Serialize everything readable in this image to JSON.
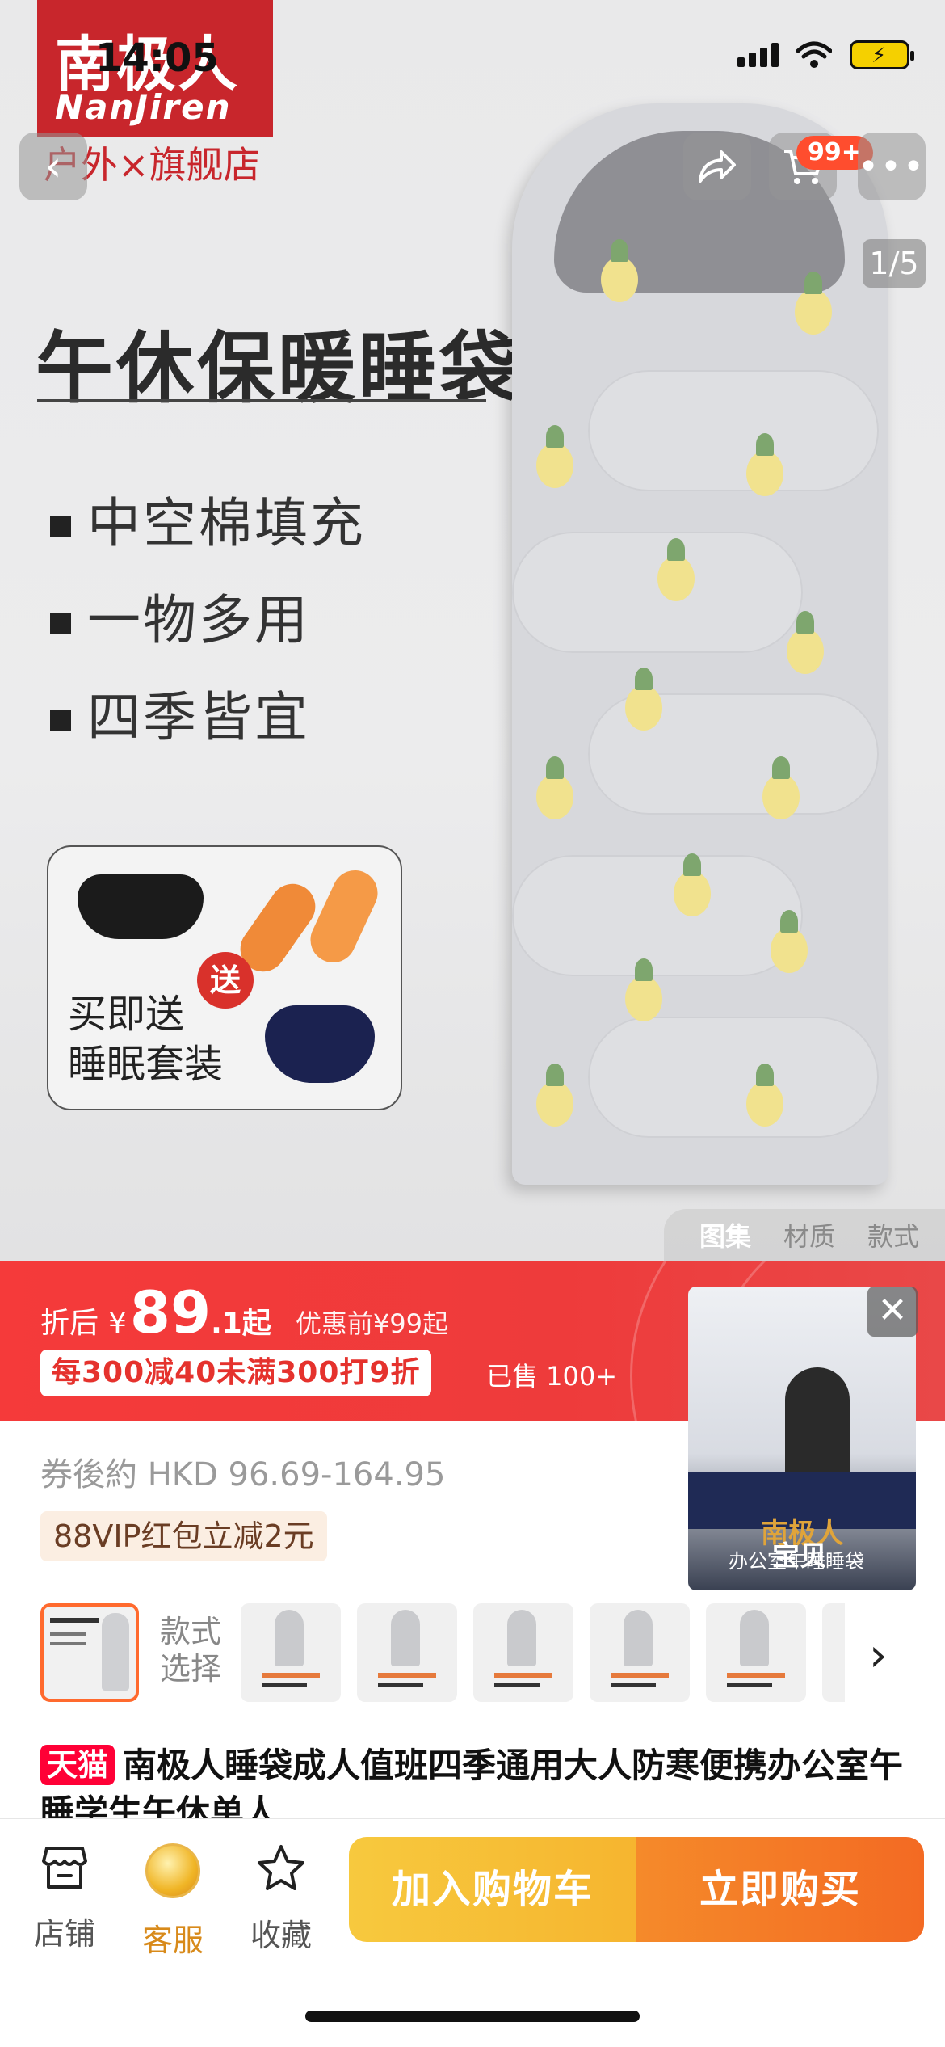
{
  "status_bar": {
    "time": "14:05"
  },
  "hero": {
    "brand_cn": "南极人",
    "brand_en": "NanJiren",
    "brand_sub": "户外×旗舰店",
    "title": "午休保暖睡袋",
    "features": [
      "中空棉填充",
      "一物多用",
      "四季皆宜"
    ],
    "gift_badge": "送",
    "gift_text_line1": "买即送",
    "gift_text_line2": "睡眠套装",
    "photo_count": "1/5",
    "gallery_tabs": [
      "图集",
      "材质",
      "款式"
    ]
  },
  "nav": {
    "back_icon": "chevron-left-icon",
    "share_icon": "share-icon",
    "cart_icon": "cart-icon",
    "cart_badge": "99+",
    "more_icon": "more-icon"
  },
  "price": {
    "after_label": "折后",
    "currency": "¥",
    "integer": "89",
    "decimal": ".1起",
    "before_text": "优惠前¥99起",
    "promo": "每300减40未满300打9折",
    "sold": "已售 100+"
  },
  "after_coupon": "券後約 HKD 96.69-164.95",
  "vip_tag": "88VIP红包立减2元",
  "video": {
    "brand": "南极人",
    "caption": "办公室午睡睡袋",
    "label": "宝贝"
  },
  "variants": {
    "label_line1": "款式",
    "label_line2": "选择",
    "count": 6
  },
  "product_title": {
    "tag": "天猫",
    "text": "南极人睡袋成人值班四季通用大人防寒便携办公室午睡学生午休单人"
  },
  "bottom_bar": {
    "shop": "店铺",
    "service": "客服",
    "favorite": "收藏",
    "add_cart": "加入购物车",
    "buy_now": "立即购买"
  },
  "colors": {
    "accent_red": "#f53a3a",
    "cart_yellow": "#f6b52f",
    "buy_orange": "#f36a23",
    "tmall_red": "#ff0036"
  }
}
